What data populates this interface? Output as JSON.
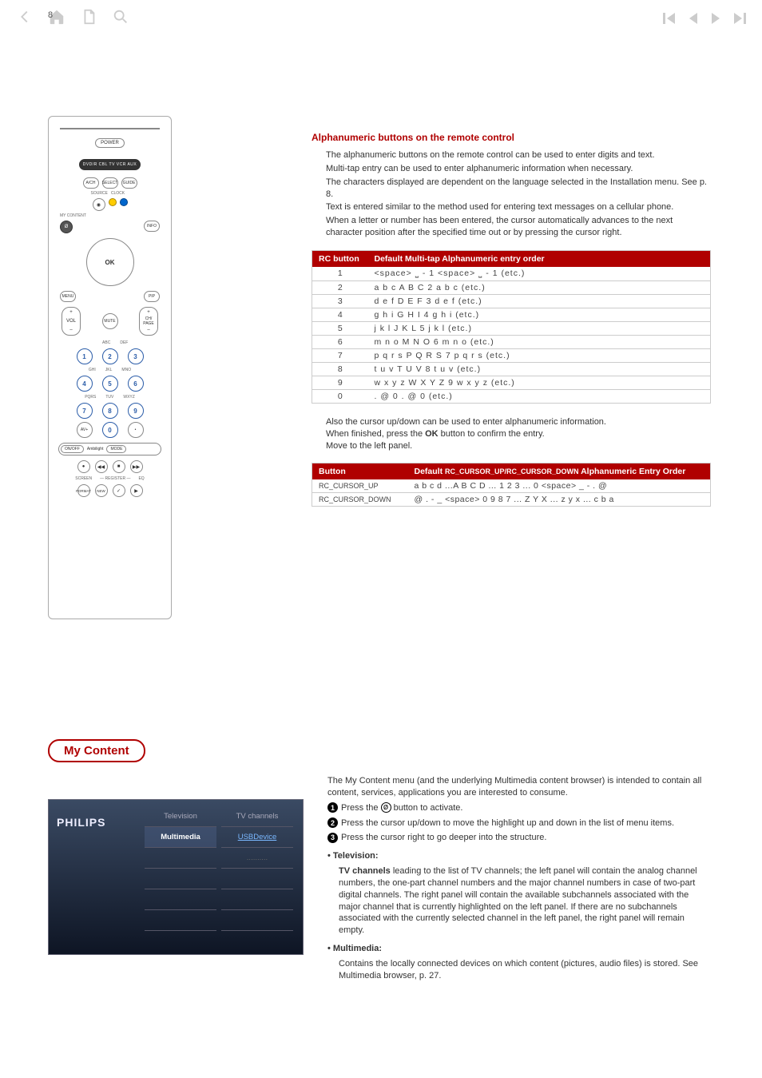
{
  "page_number": "8",
  "section_alpha": {
    "heading": "Alphanumeric buttons on the remote control",
    "body": [
      "The alphanumeric buttons on the remote control can be used to enter digits and text.",
      "Multi-tap entry can be used to enter alphanumeric information when necessary.",
      "The characters displayed are dependent on the language selected in the Installation menu. See p. 8.",
      "Text is entered similar to the method used for entering text messages on a cellular phone.",
      "When a letter or number has been entered, the cursor automatically advances to the next character position after the specified time out or by pressing the cursor right."
    ],
    "table_headers": {
      "col1": "RC button",
      "col2": "Default Multi-tap Alphanumeric entry order"
    },
    "rows": [
      {
        "btn": "1",
        "seq": "<space> ⎵ - 1 <space> ⎵ - 1 (etc.)"
      },
      {
        "btn": "2",
        "seq": "a   b   c   A   B   C   2   a   b   c    (etc.)"
      },
      {
        "btn": "3",
        "seq": "d   e   f   D   E   F   3   d   e   f    (etc.)"
      },
      {
        "btn": "4",
        "seq": "g   h   i   G   H   I   4   g   h   i    (etc.)"
      },
      {
        "btn": "5",
        "seq": "j   k   l   J   K   L   5   j   k   l    (etc.)"
      },
      {
        "btn": "6",
        "seq": "m  n   o   M  N   O  6   m   n   o    (etc.)"
      },
      {
        "btn": "7",
        "seq": "p   q   r   s   P   Q  R   S   7   p   q   r   s    (etc.)"
      },
      {
        "btn": "8",
        "seq": "t   u   v   T   U   V   8   t   u   v    (etc.)"
      },
      {
        "btn": "9",
        "seq": "w  x   y   z   W  X   Y   Z   9   w   x   y   z    (etc.)"
      },
      {
        "btn": "0",
        "seq": ".   @     0  .   @     0   (etc.)"
      }
    ],
    "mid_text": [
      "Also the cursor up/down can be used to enter alphanumeric information.",
      "When finished, press the OK button to confirm the entry.",
      "Move to the left panel."
    ],
    "cursor_table_headers": {
      "col1": "Button",
      "col2": "Default RC_CURSOR_UP/RC_CURSOR_DOWN Alphanumeric Entry Order"
    },
    "cursor_rows": [
      {
        "btn": "RC_CURSOR_UP",
        "seq": "a b c d ...A B C D ... 1 2 3 ... 0 <space> _ - . @"
      },
      {
        "btn": "RC_CURSOR_DOWN",
        "seq": "@ . - _  <space> 0 9 8 7 ... Z Y X ... z y x ... c b a"
      }
    ]
  },
  "mycontent": {
    "badge": "My Content",
    "tv_ui": {
      "logo": "PHILIPS",
      "left_items": [
        "Television",
        "Multimedia"
      ],
      "right_items": [
        "TV channels",
        "USBDevice",
        ".........."
      ]
    },
    "intro": "The My Content menu (and the underlying Multimedia content browser) is intended to contain all content, services, applications you are interested to consume.",
    "steps": [
      "Press the  Ø ⁄  button to activate.",
      "Press the cursor up/down to move the highlight up and down in the list of menu items.",
      "Press the cursor right to go deeper into the structure."
    ],
    "tv_head": "• Television:",
    "tv_strong": "TV channels",
    "tv_body": " leading to the list of TV channels; the left panel will contain the analog channel numbers, the one-part channel numbers and the major channel numbers in case of two-part digital channels. The right panel will contain the available subchannels associated with the major channel that is currently highlighted on the left panel. If there are no subchannels associated with the currently selected channel in the left panel, the right panel will remain empty.",
    "mm_head": "• Multimedia:",
    "mm_body": "Contains the locally connected devices on which content (pictures, audio files) is stored. See Multimedia browser, p. 27."
  },
  "remote": {
    "power": "POWER",
    "modes": "DVD/R  CBL  TV  VCR  AUX",
    "btn_ach": "A/CH",
    "btn_select": "SELECT",
    "btn_guide": "GUIDE",
    "lbl_source": "SOURCE",
    "lbl_clock": "CLOCK",
    "lbl_mycontent": "MY CONTENT",
    "btn_info": "INFO",
    "ok": "OK",
    "btn_menu": "MENU",
    "btn_pip": "PIP",
    "vol": "VOL",
    "mute": "MUTE",
    "ch": "CH/\nPAGE",
    "n1": "1",
    "n2": "2",
    "n3": "3",
    "n4": "4",
    "n5": "5",
    "n6": "6",
    "n7": "7",
    "n8": "8",
    "n9": "9",
    "n0": "0",
    "l2": "ABC",
    "l3": "DEF",
    "l4": "GHI",
    "l5": "JKL",
    "l6": "MNO",
    "l7": "PQRS",
    "l8": "TUV",
    "l9": "WXYZ",
    "avplus": "AV+",
    "dot": "•",
    "ambi_on": "ON/OFF",
    "ambi": "Ambilight",
    "ambi_mode": "MODE",
    "lbl_screen": "SCREEN",
    "lbl_register": "—  REGISTER  —",
    "lbl_eq": "EQ",
    "btn_format": "FORMAT",
    "btn_new": "NEW"
  }
}
